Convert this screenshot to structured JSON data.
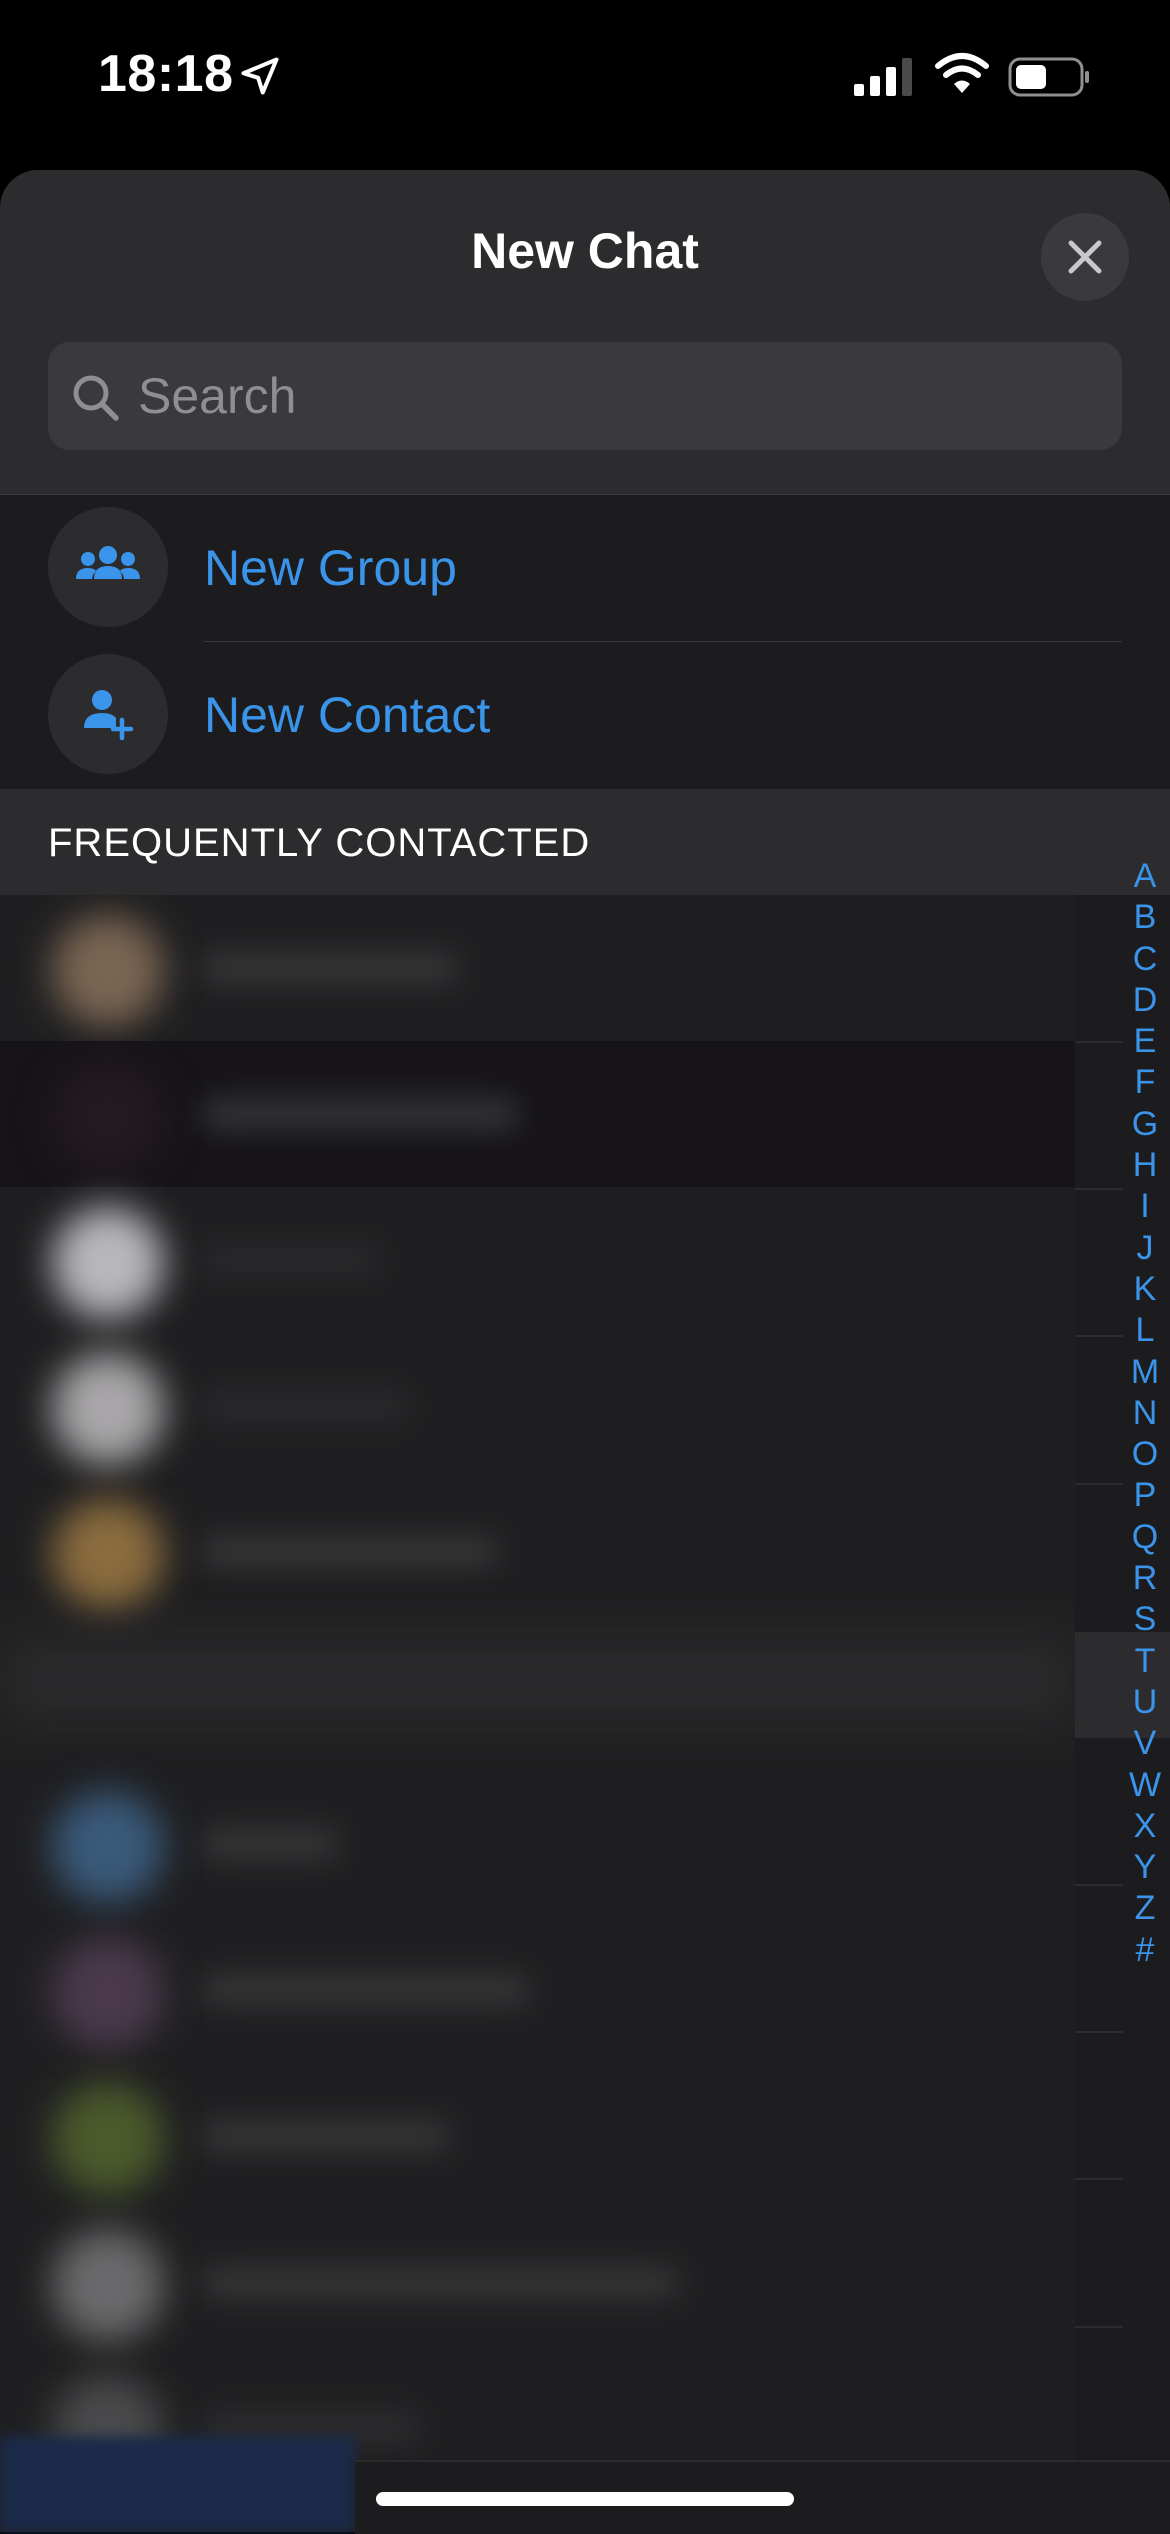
{
  "status_bar": {
    "time": "18:18",
    "icons": [
      "location-arrow-icon",
      "cellular-signal-icon",
      "wifi-icon",
      "battery-icon"
    ]
  },
  "sheet": {
    "title": "New Chat",
    "close_icon": "close-icon",
    "search": {
      "placeholder": "Search",
      "value": ""
    }
  },
  "actions": [
    {
      "label": "New Group",
      "icon": "group-icon"
    },
    {
      "label": "New Contact",
      "icon": "add-contact-icon"
    }
  ],
  "section": {
    "title": "FREQUENTLY CONTACTED"
  },
  "index_letters": [
    "A",
    "B",
    "C",
    "D",
    "E",
    "F",
    "G",
    "H",
    "I",
    "J",
    "K",
    "L",
    "M",
    "N",
    "O",
    "P",
    "Q",
    "R",
    "S",
    "T",
    "U",
    "V",
    "W",
    "X",
    "Y",
    "Z",
    "#"
  ],
  "colors": {
    "accent": "#3a94ea",
    "sheet_background": "#1c1c1e",
    "header_background": "#2c2c2e",
    "status_bar_background": "#000000"
  }
}
